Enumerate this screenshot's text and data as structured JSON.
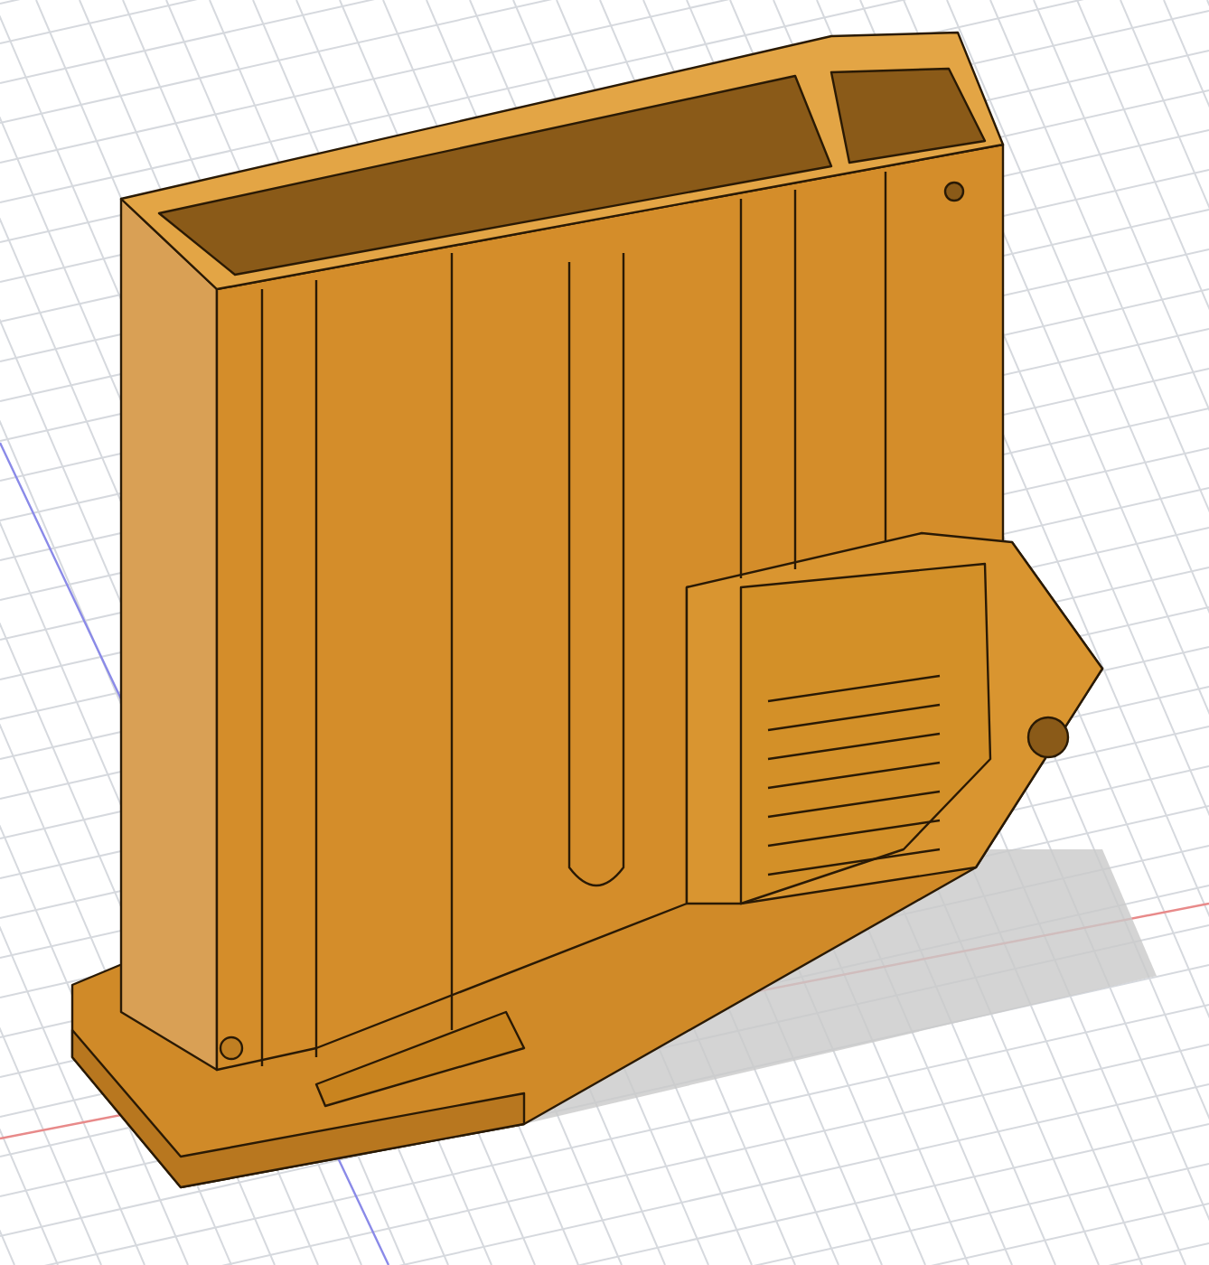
{
  "viewport": {
    "show_grid": true
  }
}
